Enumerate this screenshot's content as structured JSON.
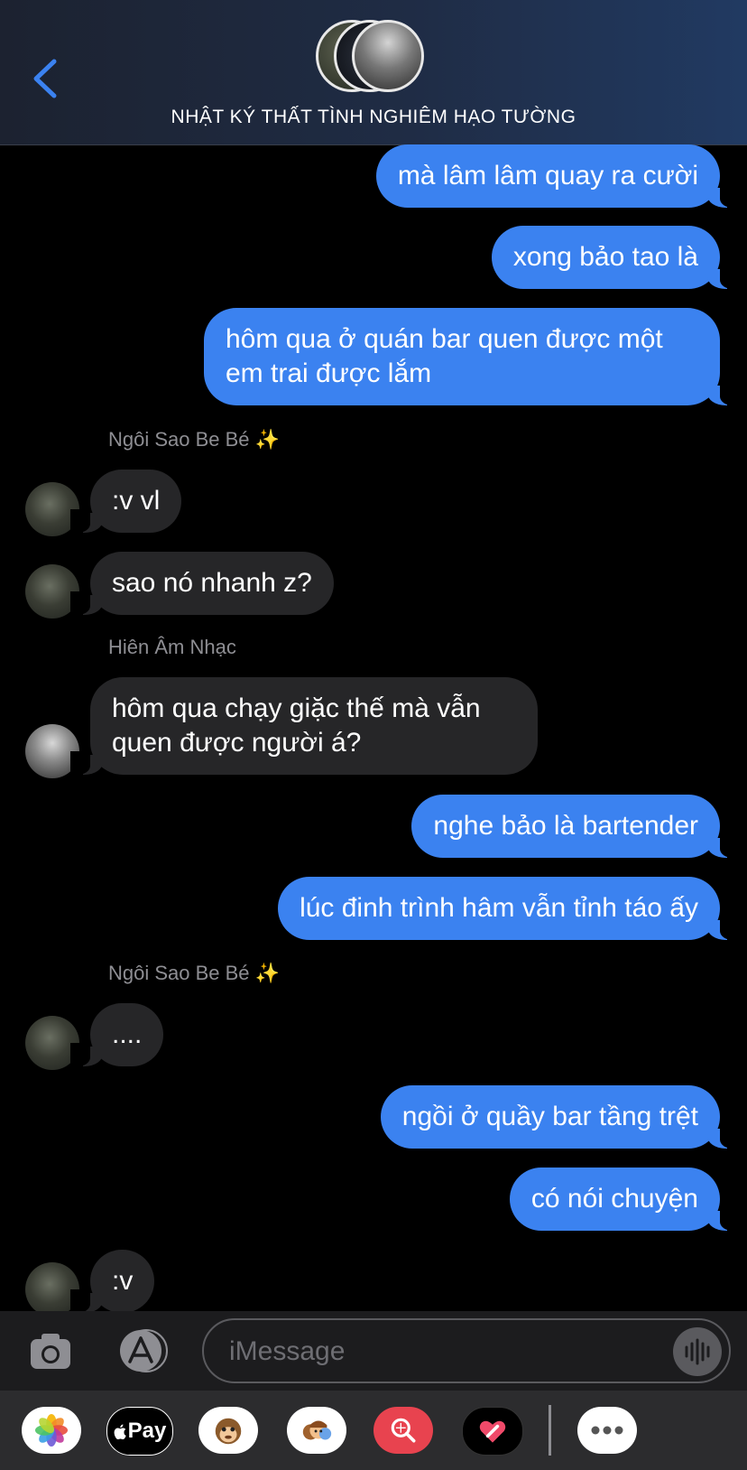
{
  "header": {
    "group_name": "NHẬT KÝ THẤT TÌNH NGHIÊM HẠO TƯỜNG",
    "accent_color": "#3b82f0"
  },
  "messages": [
    {
      "from": "me",
      "text": "mà lâm lâm quay ra cười"
    },
    {
      "from": "me",
      "text": "xong bảo tao là"
    },
    {
      "from": "me",
      "text": "hôm qua ở quán bar quen được một em trai được lắm"
    },
    {
      "sender": "Ngôi Sao Be Bé ✨"
    },
    {
      "from": "them",
      "text": ":v vl"
    },
    {
      "from": "them",
      "text": "sao nó nhanh z?"
    },
    {
      "sender": "Hiên Âm Nhạc"
    },
    {
      "from": "them",
      "text": "hôm qua chạy giặc thế mà vẫn quen được người á?"
    },
    {
      "from": "me",
      "text": "nghe bảo là bartender"
    },
    {
      "from": "me",
      "text": "lúc đinh trình hâm vẫn tỉnh táo ấy"
    },
    {
      "sender": "Ngôi Sao Be Bé ✨"
    },
    {
      "from": "them",
      "text": "...."
    },
    {
      "from": "me",
      "text": "ngồi ở quầy bar tầng trệt"
    },
    {
      "from": "me",
      "text": "có nói chuyện"
    },
    {
      "from": "them",
      "text": ":v"
    }
  ],
  "composer": {
    "placeholder": "iMessage",
    "camera_icon": "camera-icon",
    "apps_icon": "app-store-icon",
    "voice_icon": "waveform-icon"
  },
  "drawer": {
    "apps": [
      "photos",
      "apple-pay",
      "animoji",
      "memoji-stickers",
      "images-search",
      "digital-touch",
      "more"
    ],
    "apple_pay_label": "Pay"
  }
}
